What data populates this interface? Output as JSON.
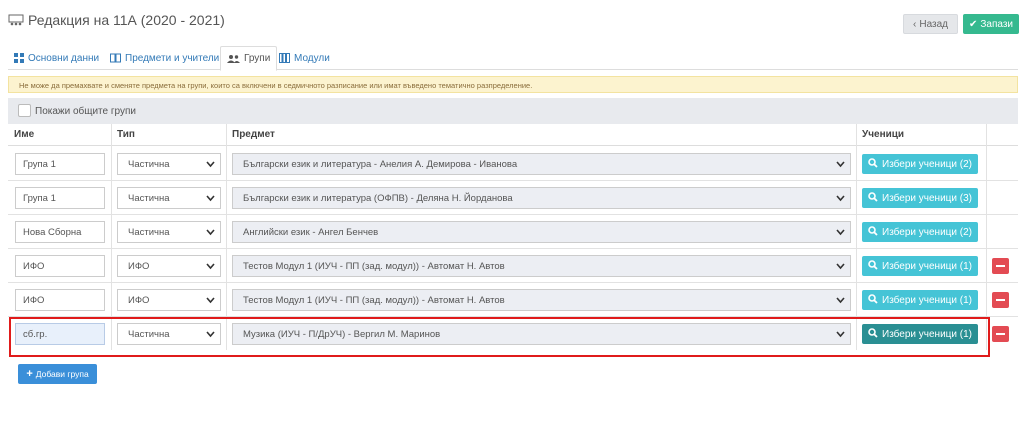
{
  "header": {
    "title": "Редакция на 11А (2020 - 2021)",
    "back_label": "Назад",
    "save_label": "Запази"
  },
  "tabs": [
    {
      "label": "Основни данни",
      "icon": "grid-icon",
      "active": false
    },
    {
      "label": "Предмети и учители",
      "icon": "book-icon",
      "active": false
    },
    {
      "label": "Групи",
      "icon": "users-icon",
      "active": true
    },
    {
      "label": "Модули",
      "icon": "library-icon",
      "active": false
    }
  ],
  "alert": {
    "text": "Не може да премахвате и сменяте предмета на групи, които са включени в седмичното разписание или имат въведено тематично разпределение."
  },
  "options": {
    "show_common_groups_label": "Покажи общите групи",
    "show_common_groups_checked": false
  },
  "table": {
    "headers": {
      "name": "Име",
      "type": "Тип",
      "subject": "Предмет",
      "students": "Ученици"
    },
    "rows": [
      {
        "name": "Група 1",
        "type": "Частична",
        "subject": "Български език и литература - Анелия А. Демирова - Иванова",
        "students_label": "Избери ученици (2)",
        "deletable": false
      },
      {
        "name": "Група 1",
        "type": "Частична",
        "subject": "Български език и литература (ОФПВ) - Деляна Н. Йорданова",
        "students_label": "Избери ученици (3)",
        "deletable": false
      },
      {
        "name": "Нова Сборна",
        "type": "Частична",
        "subject": "Английски език - Ангел Бенчев",
        "students_label": "Избери ученици (2)",
        "deletable": false
      },
      {
        "name": "ИФО",
        "type": "ИФО",
        "subject": "Тестов Модул 1 (ИУЧ - ПП (зад. модул)) - Автомат Н. Автов",
        "students_label": "Избери ученици (1)",
        "deletable": true
      },
      {
        "name": "ИФО",
        "type": "ИФО",
        "subject": "Тестов Модул 1 (ИУЧ - ПП (зад. модул)) - Автомат Н. Автов",
        "students_label": "Избери ученици (1)",
        "deletable": true
      },
      {
        "name": "сб.гр.",
        "type": "Частична",
        "subject": "Музика (ИУЧ - П/ДрУЧ) - Вергил М. Маринов",
        "students_label": "Избери ученици (1)",
        "deletable": true
      }
    ]
  },
  "add_group_label": "Добави група",
  "colors": {
    "save": "#35b98f",
    "students_button": "#45c4d6",
    "students_button_active": "#2a8f93",
    "delete": "#e34b53",
    "add": "#3a8fd9",
    "alert_bg": "#fcf3cf",
    "highlight": "#e01b1b"
  }
}
